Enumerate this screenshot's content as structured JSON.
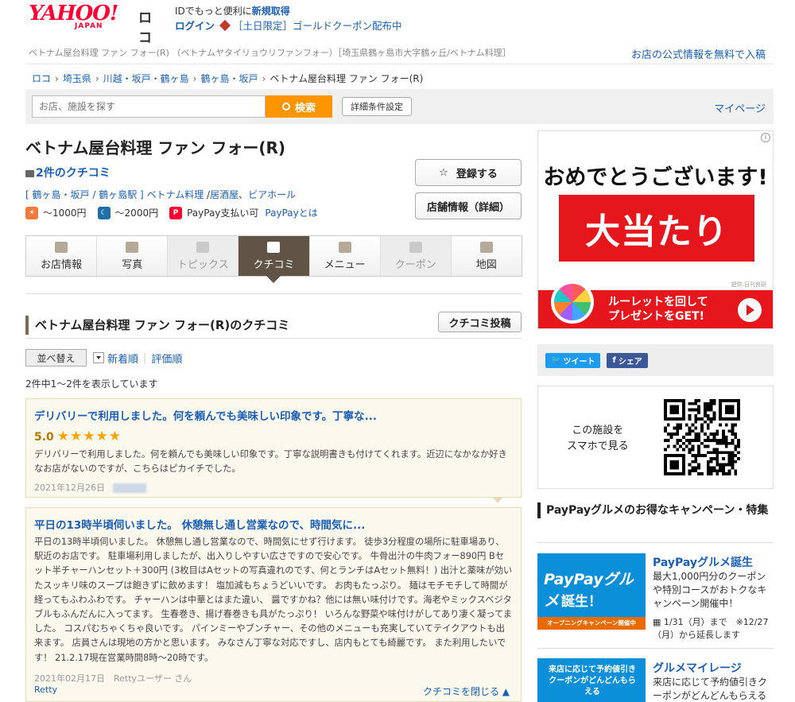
{
  "header": {
    "logo_text": "YAHOO!",
    "logo_sub": "JAPAN",
    "service_name": "ロコ",
    "promo_line_prefix": "IDでもっと便利に",
    "signup_link": "新規取得",
    "login_link": "ログイン",
    "campaign_link": "［土日限定］ゴールドクーポン配布中"
  },
  "subnav": {
    "text": "ベトナム屋台料理 ファン フォー(R) （ベトナムヤタイリョウリファンフォー）［埼玉県鶴ヶ島市大字鶴ヶ丘/ベトナム料理］",
    "official_link": "お店の公式情報を無料で入稿"
  },
  "breadcrumb": [
    "ロコ",
    "埼玉県",
    "川越・坂戸・鶴ヶ島",
    "鶴ヶ島・坂戸",
    "ベトナム屋台料理 ファン フォー(R)"
  ],
  "search": {
    "placeholder": "お店、施設を探す",
    "button": "検索",
    "detail_button": "詳細条件設定",
    "mypage": "マイページ"
  },
  "shop": {
    "name": "ベトナム屋台料理 ファン フォー(R)",
    "review_count": "2件のクチコミ",
    "area_bracket_open": "[",
    "area1": "鶴ヶ島・坂戸",
    "area_sep": " / ",
    "area2": "鶴ヶ島駅",
    "area_bracket_close": "]",
    "genre1": "ベトナム料理",
    "genre2": "居酒屋、ビアホール",
    "lunch_price": "～1000円",
    "dinner_price": "～2000円",
    "paypay": "PayPay支払い可",
    "paypay_link": "PayPayとは",
    "register_button": "登録する",
    "info_button": "店舗情報（詳細）"
  },
  "tabs": [
    {
      "label": "お店情報",
      "state": "normal"
    },
    {
      "label": "写真",
      "state": "normal"
    },
    {
      "label": "トピックス",
      "state": "disabled"
    },
    {
      "label": "クチコミ",
      "state": "active"
    },
    {
      "label": "メニュー",
      "state": "normal"
    },
    {
      "label": "クーポン",
      "state": "disabled"
    },
    {
      "label": "地図",
      "state": "normal"
    }
  ],
  "reviews_section": {
    "title": "ベトナム屋台料理 ファン フォー(R)のクチコミ",
    "post_button": "クチコミ投稿",
    "sort_button": "並べ替え",
    "sort_new": "新着順",
    "sort_rating": "評価順",
    "count_text": "2件中1～2件を表示しています",
    "close_link": "クチコミを閉じる ▲"
  },
  "reviews": [
    {
      "title": "デリバリーで利用しました。何を頼んでも美味しい印象です。丁寧な...",
      "score": "5.0",
      "stars": "★★★★★",
      "body": "デリバリーで利用しました。何を頼んでも美味しい印象です。丁寧な説明書きも付けてくれます。近辺になかなか好きなお店がないのですが、こちらはピカイチでした。",
      "date": "2021年12月26日"
    },
    {
      "title": "平日の13時半頃伺いました。 休憩無し通し営業なので、時間気に...",
      "body": "平日の13時半頃伺いました。 休憩無し通し営業なので、時間気にせず行けます。 徒歩3分程度の場所に駐車場あり、駅近のお店です。 駐車場利用しましたが、出入りしやすい広さですので安心です。 牛骨出汁の牛肉フォー890円 Bセット半チャーハンセット＋300円 (3枚目はAセットの写真違れのです、何とランチはAセット無料！) 出汁と薬味が効いたスッキリ味のスープは飽きずに飲めます！ 塩加減もちょうどいいです。 お肉もたっぷり。 麺はモチモチして時間が経ってもふわふわです。 チャーハンは中華とはまた違い、 醤ですかね？他には無い味付けです。海老やミックスベジタブルもふんだんに入ってます。 生春巻き、揚げ春巻きも具がたっぷり！ いろんな野菜や味付けがしてあり凄く凝ってました。 コスパむちゃくちゃ良いです。 パインミーやブンチャー、その他のメニューも充実していてテイクアウトも出来ます。 店員さんは現地の方かと思います。 みなさん丁寧な対応ですし、店内もとても綺麗です。 また利用したいです！ 21.2.17現在営業時間8時～20時です。",
      "date": "2021年02月17日",
      "author": "Rettyユーザー さん",
      "source": "Retty"
    }
  ],
  "ad": {
    "headline": "おめでとうございます!",
    "box_text": "大当たり",
    "credit": "提供:日刊良研",
    "cta_line1": "ルーレットを回して",
    "cta_line2": "プレゼントをGET!"
  },
  "share": {
    "tweet": "ツイート",
    "facebook": "シェア"
  },
  "qr": {
    "line1": "この施設を",
    "line2": "スマホで見る"
  },
  "promo": {
    "title": "PayPayグルメのお得なキャンペーン・特集",
    "items": [
      {
        "img_line1": "PayPayグルメ",
        "img_line2": "誕生！",
        "img_band": "オープニングキャンペーン開催中",
        "title": "PayPayグルメ誕生",
        "desc": "最大1,000円分のクーポンや特別コースがおトクなキャンペーン開催中！",
        "date": "1/31（月）まで　※12/27（月）から延長します"
      },
      {
        "img_text": "来店に応じて予約値引きクーポンがどんどんもらえる",
        "title": "グルメマイレージ",
        "desc": "来店に応じて予約値引きクーポンがどんどんもらえる"
      }
    ]
  },
  "colors": {
    "link": "#1a5fb4",
    "search_button": "#ff9500",
    "active_tab": "#5f5445",
    "yahoo_red": "#ff0033",
    "ad_red": "#e5171d",
    "review_bg": "#fbf8ee",
    "star": "#f4a300"
  }
}
